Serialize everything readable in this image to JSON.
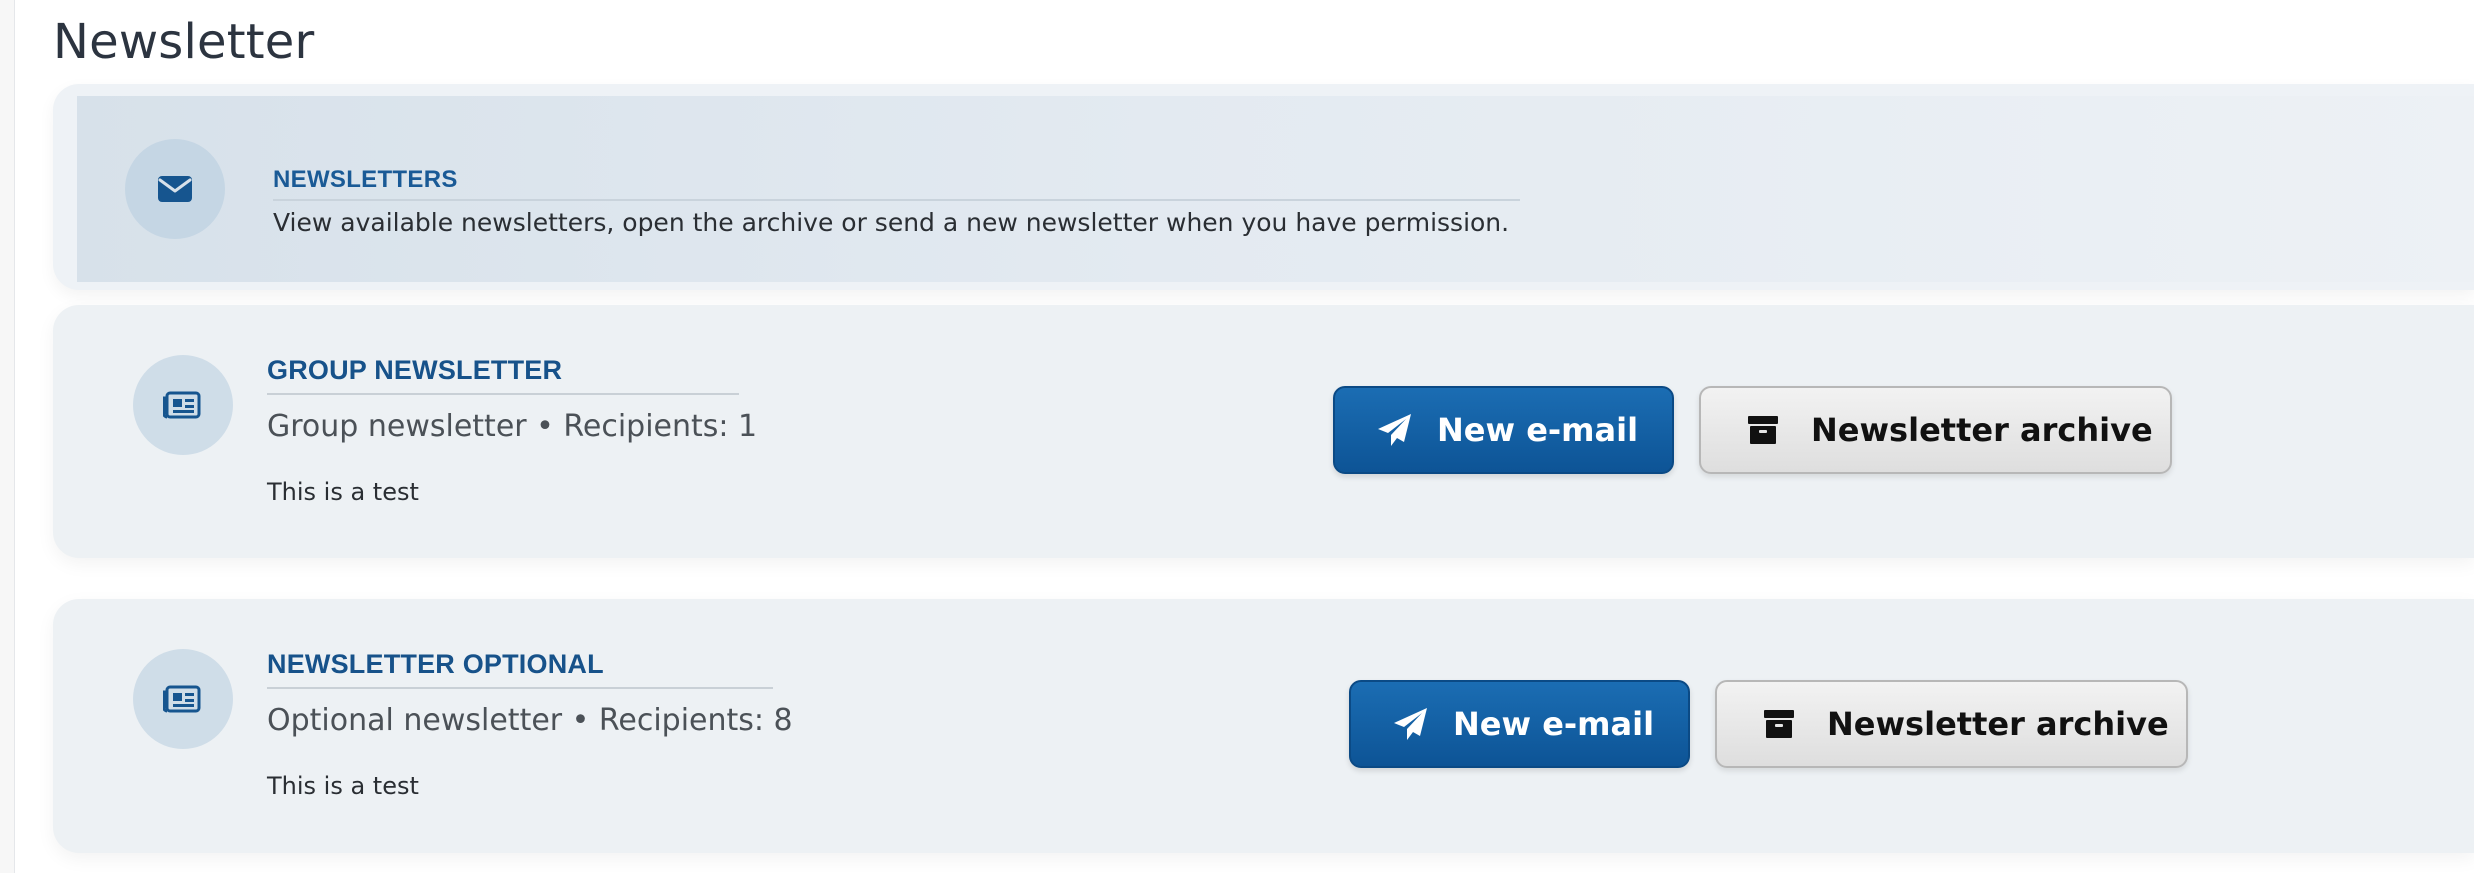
{
  "page": {
    "title": "Newsletter"
  },
  "intro": {
    "icon": "envelope-icon",
    "title": "NEWSLETTERS",
    "description": "View available newsletters, open the archive or send a new newsletter when you have permission."
  },
  "newsletters": [
    {
      "icon": "newspaper-icon",
      "title": "GROUP NEWSLETTER",
      "subtitle": "Group newsletter • Recipients: 1",
      "description": "This is a test",
      "new_email_label": "New e-mail",
      "new_email_icon": "paper-plane-icon",
      "archive_label": "Newsletter archive",
      "archive_icon": "archive-box-icon"
    },
    {
      "icon": "newspaper-icon",
      "title": "NEWSLETTER OPTIONAL",
      "subtitle": "Optional newsletter • Recipients: 8",
      "description": "This is a test",
      "new_email_label": "New e-mail",
      "new_email_icon": "paper-plane-icon",
      "archive_label": "Newsletter archive",
      "archive_icon": "archive-box-icon"
    }
  ],
  "colors": {
    "accent": "#1a5a96",
    "primary_button": "#0d5496",
    "card_background": "#edf1f4",
    "intro_background": "#d7e1ea"
  }
}
